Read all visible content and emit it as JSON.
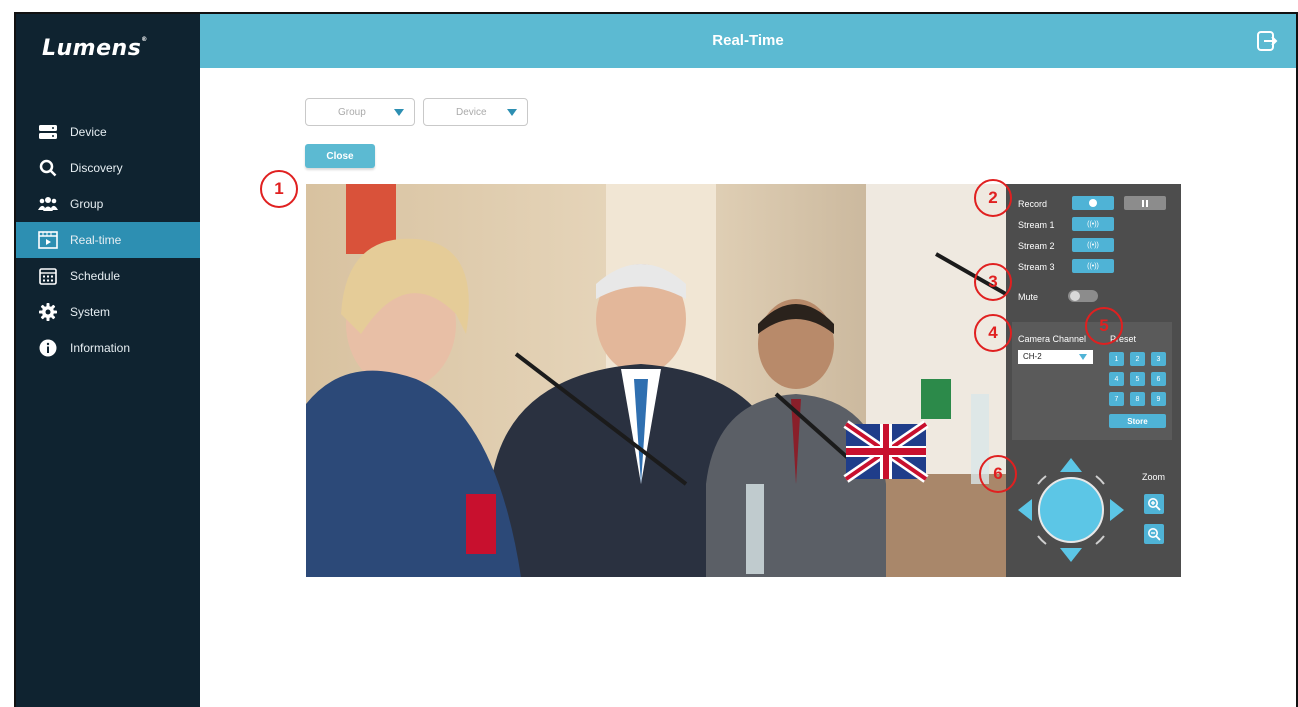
{
  "app": {
    "logo": "Lumens",
    "title": "Real-Time"
  },
  "sidebar": {
    "items": [
      {
        "label": "Device",
        "icon": "server-icon",
        "active": false
      },
      {
        "label": "Discovery",
        "icon": "search-icon",
        "active": false
      },
      {
        "label": "Group",
        "icon": "users-icon",
        "active": false
      },
      {
        "label": "Real-time",
        "icon": "video-icon",
        "active": true
      },
      {
        "label": "Schedule",
        "icon": "calendar-icon",
        "active": false
      },
      {
        "label": "System",
        "icon": "gear-icon",
        "active": false
      },
      {
        "label": "Information",
        "icon": "info-icon",
        "active": false
      }
    ]
  },
  "filters": {
    "group_placeholder": "Group",
    "device_placeholder": "Device"
  },
  "actions": {
    "close_label": "Close"
  },
  "panel": {
    "record_label": "Record",
    "stream1_label": "Stream 1",
    "stream2_label": "Stream 2",
    "stream3_label": "Stream 3",
    "stream_icon": "((•))",
    "mute_label": "Mute",
    "camera_channel_label": "Camera Channel",
    "camera_channel_value": "CH-2",
    "preset_label": "Preset",
    "presets": [
      "1",
      "2",
      "3",
      "4",
      "5",
      "6",
      "7",
      "8",
      "9"
    ],
    "store_label": "Store",
    "zoom_label": "Zoom"
  },
  "callouts": [
    "1",
    "2",
    "3",
    "4",
    "5",
    "6"
  ],
  "colors": {
    "sidebar": "#0f2330",
    "accent": "#5cbad2",
    "active": "#2d8fb2",
    "panel": "#4d4d4d",
    "callout": "#e02020"
  }
}
